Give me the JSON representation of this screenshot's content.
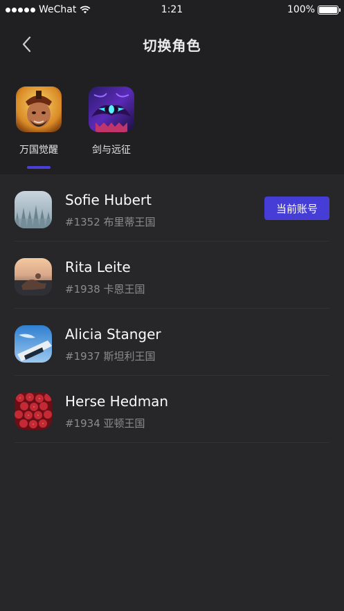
{
  "status_bar": {
    "carrier": "WeChat",
    "time": "1:21",
    "battery": "100%",
    "battery_level": 1.0
  },
  "nav": {
    "title": "切换角色",
    "back_icon": "chevron-left-icon"
  },
  "games": [
    {
      "label": "万国觉醒",
      "active": true
    },
    {
      "label": "剑与远征",
      "active": false
    }
  ],
  "roles": [
    {
      "name": "Sofie Hubert",
      "subtitle": "#1352 布里蒂王国",
      "is_current": true
    },
    {
      "name": "Rita Leite",
      "subtitle": "#1938 卡恩王国",
      "is_current": false
    },
    {
      "name": "Alicia Stanger",
      "subtitle": "#1937 斯坦利王国",
      "is_current": false
    },
    {
      "name": "Herse Hedman",
      "subtitle": "#1934 亚顿王国",
      "is_current": false
    }
  ],
  "current_badge_label": "当前账号",
  "colors": {
    "background": "#272729",
    "header": "#202022",
    "accent": "#463cd6",
    "secondary_text": "#8c8c8e"
  }
}
